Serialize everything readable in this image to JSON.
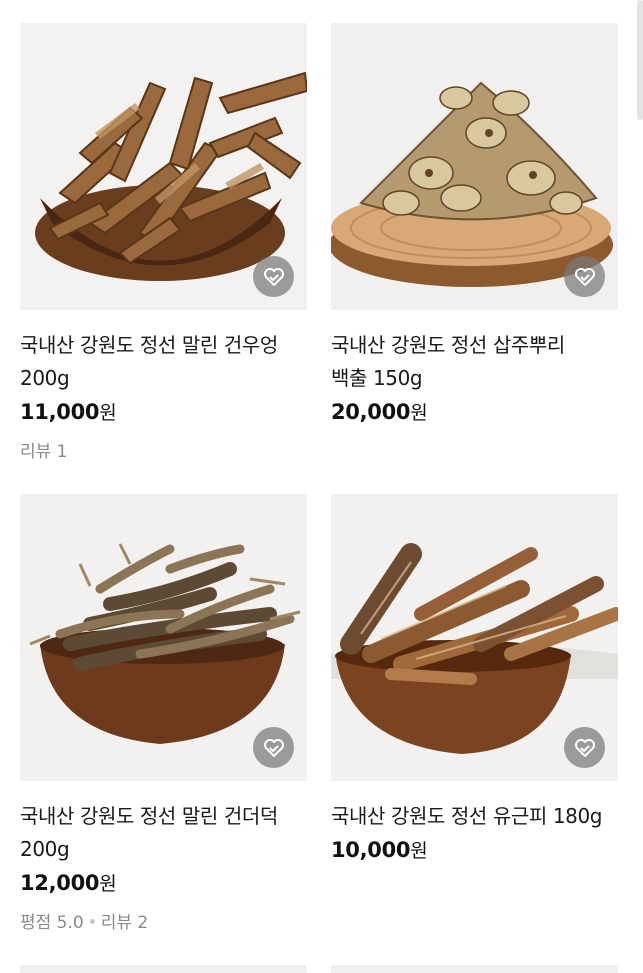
{
  "products": [
    {
      "title_line1": "국내산 강원도 정선 말린 건우엉",
      "title_line2": "200g",
      "price": "11,000",
      "currency": "원",
      "rating": "",
      "review": "리뷰 1",
      "image": "dried-burdock-in-wooden-bowl"
    },
    {
      "title_line1": "국내산 강원도 정선 삽주뿌리",
      "title_line2": "백출 150g",
      "price": "20,000",
      "currency": "원",
      "rating": "",
      "review": "",
      "image": "atractylodes-root-on-wood-slab"
    },
    {
      "title_line1": "국내산 강원도 정선 말린 건더덕",
      "title_line2": "200g",
      "price": "12,000",
      "currency": "원",
      "rating": "평점 5.0",
      "review": "리뷰 2",
      "image": "dried-deodeok-in-wooden-bowl"
    },
    {
      "title_line1": "국내산 강원도 정선 유근피 180g",
      "title_line2": "",
      "price": "10,000",
      "currency": "원",
      "rating": "",
      "review": "",
      "image": "elm-root-bark-in-wooden-bowl"
    }
  ],
  "icons": {
    "wishlist": "heart-check-icon"
  },
  "colors": {
    "wish_bg": "#7a7a7a",
    "meta_text": "#8a8a8a"
  }
}
